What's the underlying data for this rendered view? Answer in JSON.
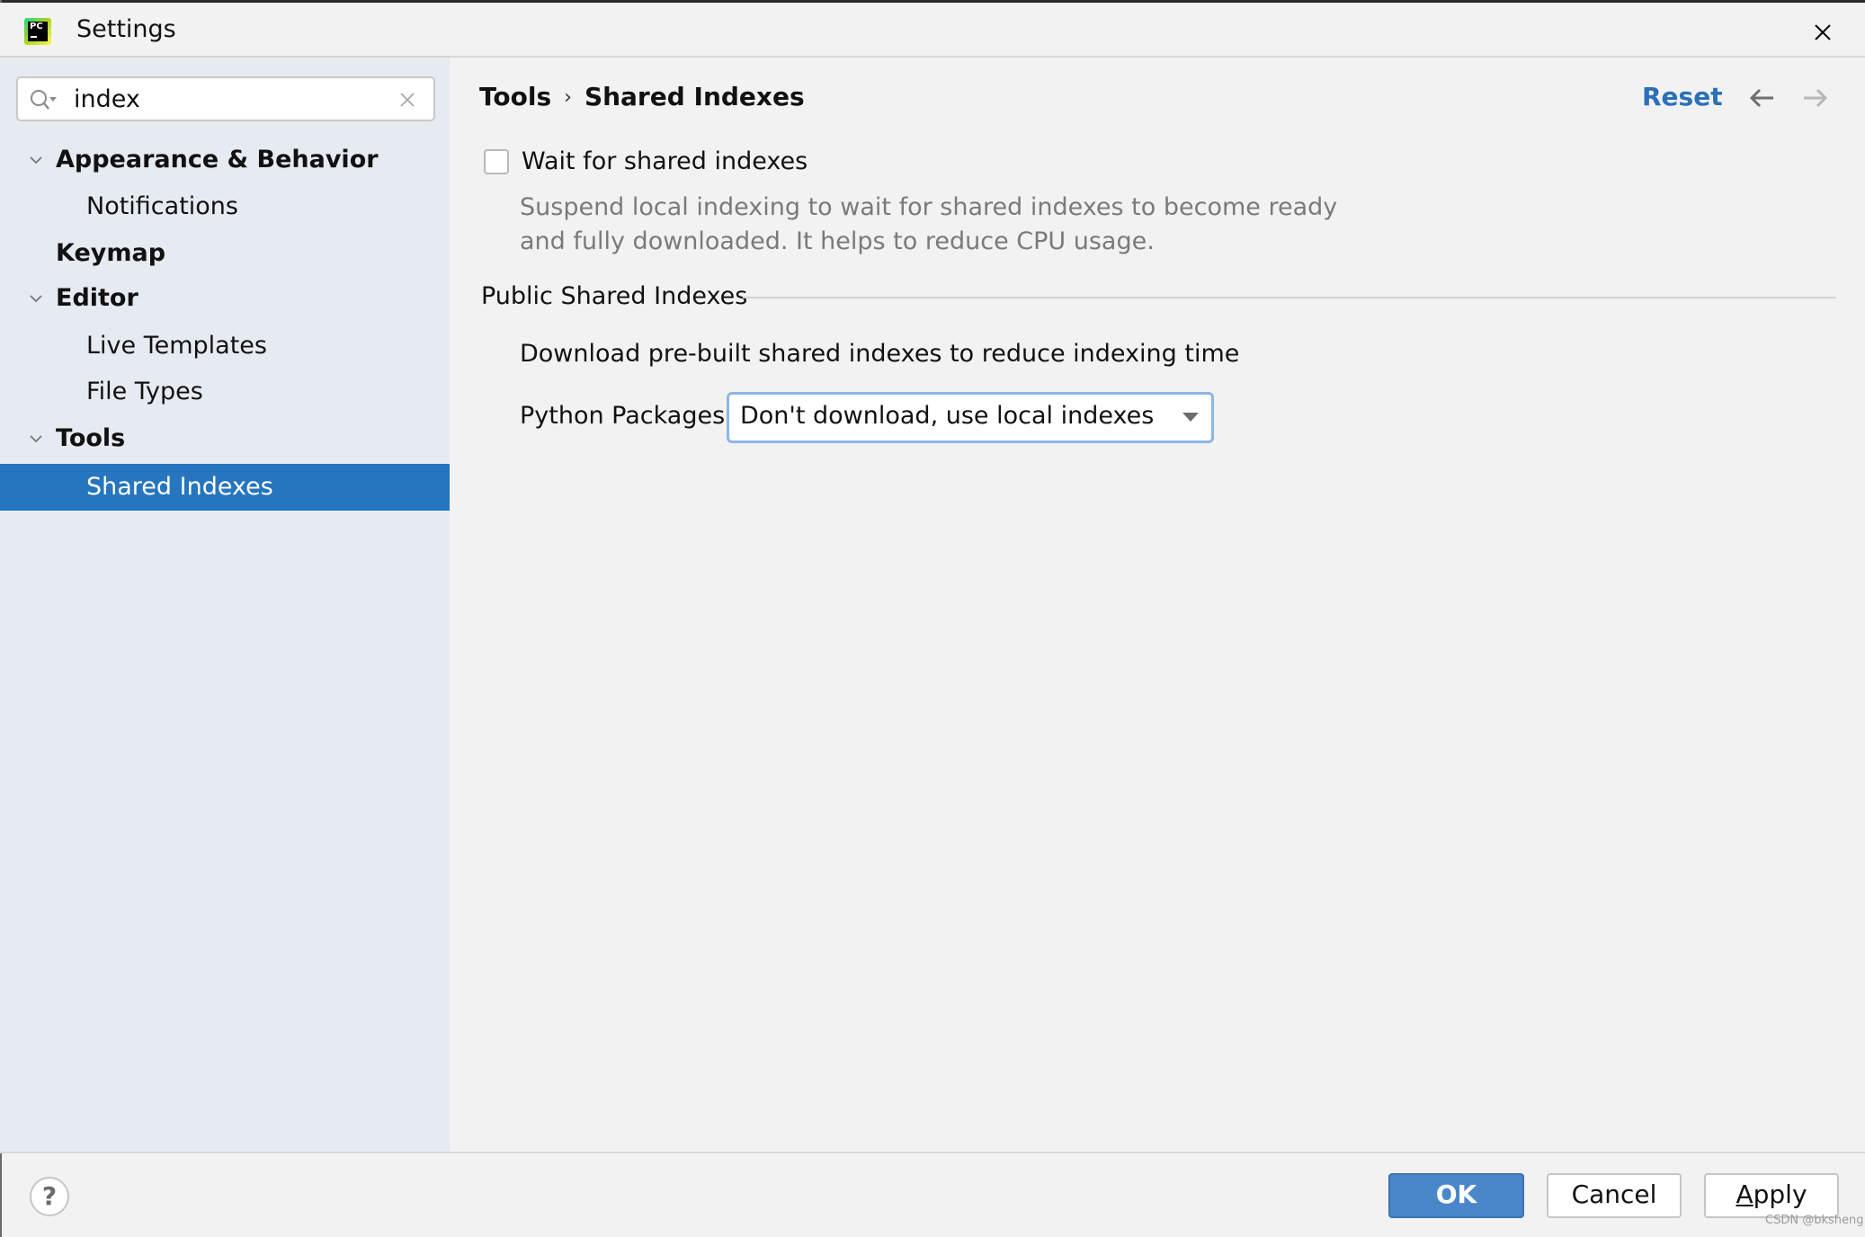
{
  "window": {
    "title": "Settings",
    "app_logo_text": "PC",
    "close_icon": "close-icon"
  },
  "search": {
    "value": "index",
    "placeholder": ""
  },
  "sidebar": {
    "items": [
      {
        "label": "Appearance & Behavior",
        "level": 0,
        "expanded": true
      },
      {
        "label": "Notifications",
        "level": 1
      },
      {
        "label": "Keymap",
        "level": 0
      },
      {
        "label": "Editor",
        "level": 0,
        "expanded": true
      },
      {
        "label": "Live Templates",
        "level": 1
      },
      {
        "label": "File Types",
        "level": 1
      },
      {
        "label": "Tools",
        "level": 0,
        "expanded": true
      },
      {
        "label": "Shared Indexes",
        "level": 1,
        "selected": true
      }
    ]
  },
  "header": {
    "breadcrumb": [
      "Tools",
      "Shared Indexes"
    ],
    "breadcrumb_separator": "›",
    "reset_label": "Reset"
  },
  "content": {
    "wait_checkbox": {
      "label": "Wait for shared indexes",
      "checked": false,
      "description_line1": "Suspend local indexing to wait for shared indexes to become ready",
      "description_line2": "and fully downloaded. It helps to reduce CPU usage."
    },
    "public_group": {
      "title": "Public Shared Indexes",
      "description": "Download pre-built shared indexes to reduce indexing time",
      "python_label": "Python Packages:",
      "python_value": "Don't download, use local indexes"
    }
  },
  "footer": {
    "help_label": "?",
    "ok_label": "OK",
    "cancel_label": "Cancel",
    "apply_label_underlined": "A",
    "apply_label_rest": "pply"
  },
  "watermark": "CSDN @bksheng",
  "colors": {
    "accent": "#2675bf",
    "link": "#2a70b8",
    "ok_button": "#4a87c8",
    "sidebar_bg": "#e6ebf1",
    "focus_ring": "#8cb6e8"
  }
}
